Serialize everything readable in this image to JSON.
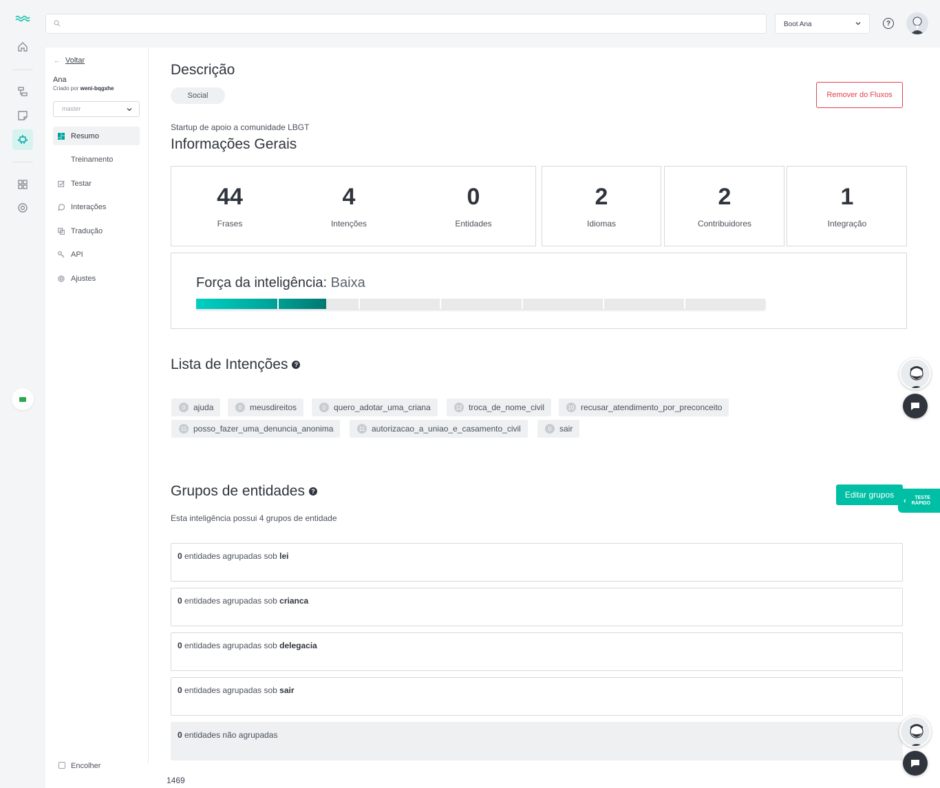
{
  "topbar": {
    "search_placeholder": "",
    "bot_selector": "Boot Ana",
    "help_icon": "?"
  },
  "sidebar": {
    "back_label": "Voltar",
    "bot_name": "Ana",
    "created_by_label": "Criado por",
    "creator": "weni-bqgxhe",
    "branch": "master",
    "items": [
      {
        "label": "Resumo",
        "icon": "dashboard-icon",
        "active": true
      },
      {
        "label": "Treinamento",
        "icon": "",
        "active": false
      },
      {
        "label": "Testar",
        "icon": "check-icon",
        "active": false
      },
      {
        "label": "Interações",
        "icon": "chat-icon",
        "active": false
      },
      {
        "label": "Tradução",
        "icon": "translate-icon",
        "active": false
      },
      {
        "label": "API",
        "icon": "key-icon",
        "active": false
      },
      {
        "label": "Ajustes",
        "icon": "gear-icon",
        "active": false
      }
    ],
    "collapse_label": "Encolher"
  },
  "description": {
    "title": "Descrição",
    "category": "Social",
    "remove_button": "Remover do Fluxos",
    "text": "Startup de apoio a comunidade LBGT"
  },
  "general_info": {
    "title": "Informações Gerais",
    "stats": [
      {
        "value": "44",
        "label": "Frases"
      },
      {
        "value": "4",
        "label": "Intenções"
      },
      {
        "value": "0",
        "label": "Entidades"
      },
      {
        "value": "2",
        "label": "Idiomas"
      },
      {
        "value": "2",
        "label": "Contribuidores"
      },
      {
        "value": "1",
        "label": "Integração"
      }
    ]
  },
  "intelligence_force": {
    "label": "Força da inteligência:",
    "level": "Baixa",
    "fill_fraction": 0.228,
    "segments": 7
  },
  "intents": {
    "title": "Lista de Intenções",
    "items": [
      {
        "count": "0",
        "name": "ajuda"
      },
      {
        "count": "0",
        "name": "meusdireitos"
      },
      {
        "count": "0",
        "name": "quero_adotar_uma_criana"
      },
      {
        "count": "12",
        "name": "troca_de_nome_civil"
      },
      {
        "count": "10",
        "name": "recusar_atendimento_por_preconceito"
      },
      {
        "count": "11",
        "name": "posso_fazer_uma_denuncia_anonima"
      },
      {
        "count": "11",
        "name": "autorizacao_a_uniao_e_casamento_civil"
      },
      {
        "count": "0",
        "name": "sair"
      }
    ]
  },
  "entity_groups": {
    "title": "Grupos de entidades",
    "edit_button": "Editar grupos",
    "subtitle": "Esta inteligência possui 4 grupos de entidade",
    "grouped_text": "entidades agrupadas sob",
    "groups": [
      {
        "count": "0",
        "name": "lei"
      },
      {
        "count": "0",
        "name": "crianca"
      },
      {
        "count": "0",
        "name": "delegacia"
      },
      {
        "count": "0",
        "name": "sair"
      }
    ],
    "ungrouped": {
      "count": "0",
      "text": "entidades não agrupadas"
    }
  },
  "footer": {
    "count": "1469"
  },
  "quick_test": {
    "line1": "TESTE",
    "line2": "RÁPIDO"
  },
  "colors": {
    "accent": "#00bfa5",
    "danger": "#e2424b",
    "text": "#2f343d"
  }
}
